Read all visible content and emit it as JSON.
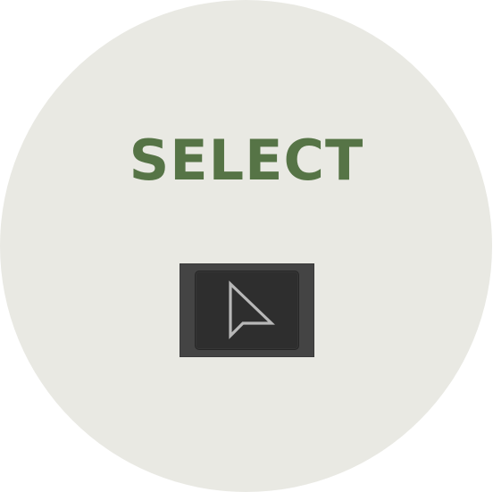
{
  "title": "SELECT",
  "tool": {
    "icon": "pointer-arrow-icon",
    "accent_color": "#567446",
    "background_color": "#e9e9e3",
    "button_color": "#2e2e2e"
  }
}
